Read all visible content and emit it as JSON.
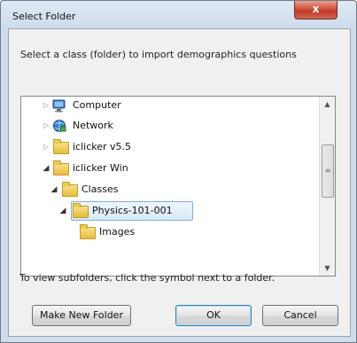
{
  "window": {
    "title": "Select Folder",
    "close_glyph": "x"
  },
  "instruction": "Select a class (folder) to import demographics questions",
  "tree": {
    "items": [
      {
        "label": "Computer",
        "icon": "computer-icon",
        "expanded": false
      },
      {
        "label": "Network",
        "icon": "network-icon",
        "expanded": false
      },
      {
        "label": "iclicker v5.5",
        "icon": "folder-icon",
        "expanded": false
      },
      {
        "label": "iclicker Win",
        "icon": "folder-icon",
        "expanded": true
      },
      {
        "label": "Classes",
        "icon": "folder-icon",
        "expanded": true
      },
      {
        "label": "Physics-101-001",
        "icon": "folder-icon",
        "expanded": true,
        "selected": true
      },
      {
        "label": "Images",
        "icon": "folder-icon",
        "expanded": false
      }
    ]
  },
  "hint": "To view subfolders, click the symbol next to a folder.",
  "buttons": {
    "make_new_folder": "Make New Folder",
    "ok": "OK",
    "cancel": "Cancel"
  },
  "colors": {
    "selection": "#d7eafb",
    "close_button": "#c0392b",
    "folder": "#e8bc3e"
  }
}
